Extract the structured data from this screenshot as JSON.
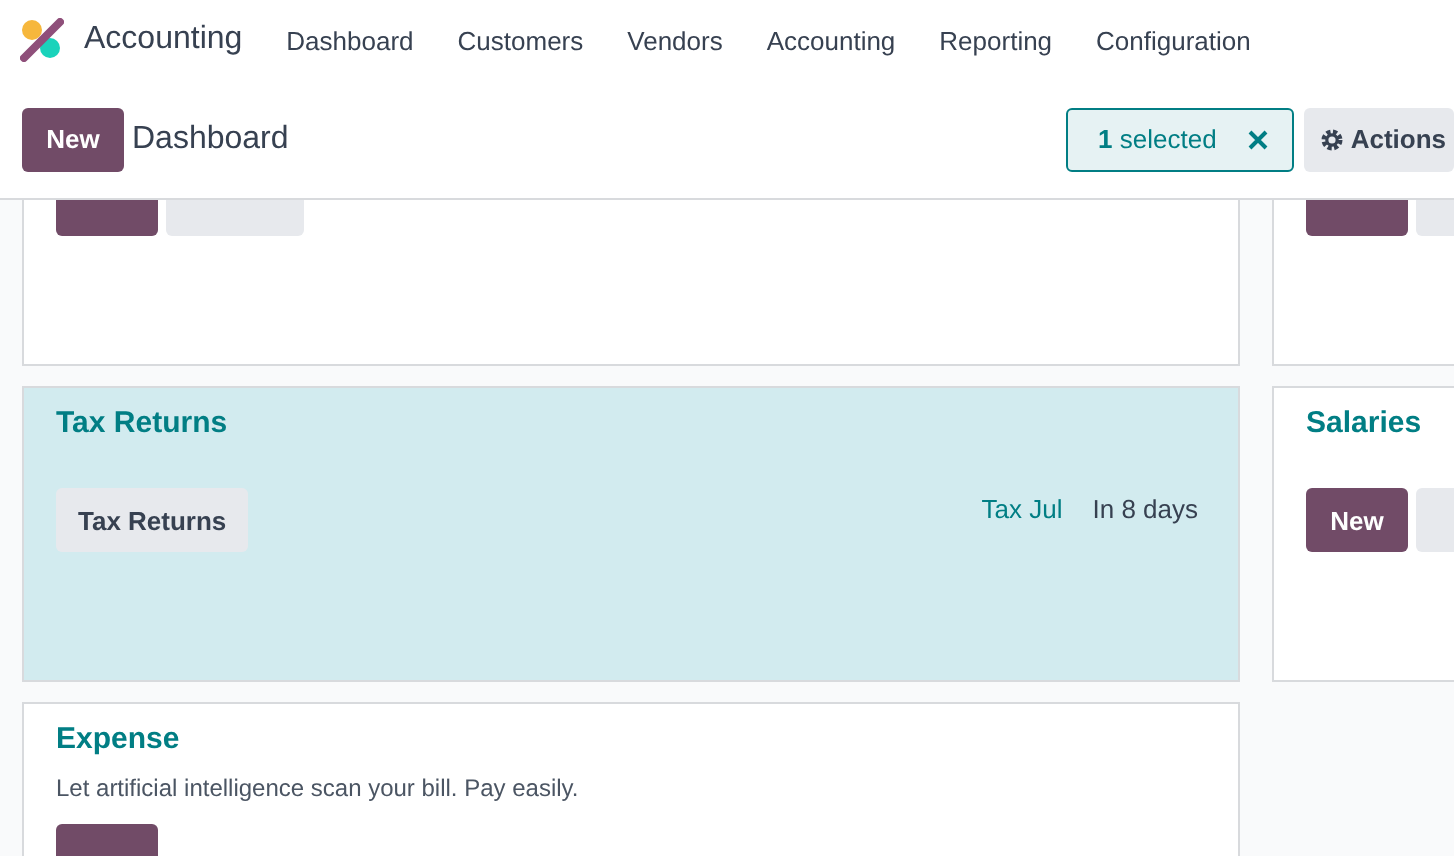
{
  "app": {
    "name": "Accounting"
  },
  "menu": [
    {
      "label": "Dashboard"
    },
    {
      "label": "Customers"
    },
    {
      "label": "Vendors"
    },
    {
      "label": "Accounting"
    },
    {
      "label": "Reporting"
    },
    {
      "label": "Configuration"
    }
  ],
  "control_bar": {
    "new_button": "New",
    "breadcrumb": "Dashboard",
    "selection": {
      "text": "**1** selected"
    },
    "actions": "Actions"
  },
  "columns": [
    [
      {
        "selected": false,
        "buttons": [
          {
            "kind": "primary"
          },
          {
            "kind": "secondary"
          }
        ]
      },
      {
        "title": "Tax Returns",
        "selected": true,
        "buttons": [
          {
            "label": "Tax Returns",
            "kind": "secondary"
          }
        ],
        "activity": {
          "name": "Tax Jul",
          "due": "In 8 days"
        }
      },
      {
        "title": "Expense",
        "description": "Let artificial intelligence scan your bill. Pay easily.",
        "selected": false,
        "buttons": [
          {
            "kind": "primary"
          }
        ]
      }
    ],
    [
      {
        "selected": false,
        "buttons": [
          {
            "kind": "primary"
          },
          {
            "kind": "secondary"
          }
        ]
      },
      {
        "title": "Salaries",
        "selected": false,
        "buttons": [
          {
            "label": "New",
            "kind": "primary"
          },
          {
            "kind": "secondary"
          }
        ]
      }
    ]
  ]
}
